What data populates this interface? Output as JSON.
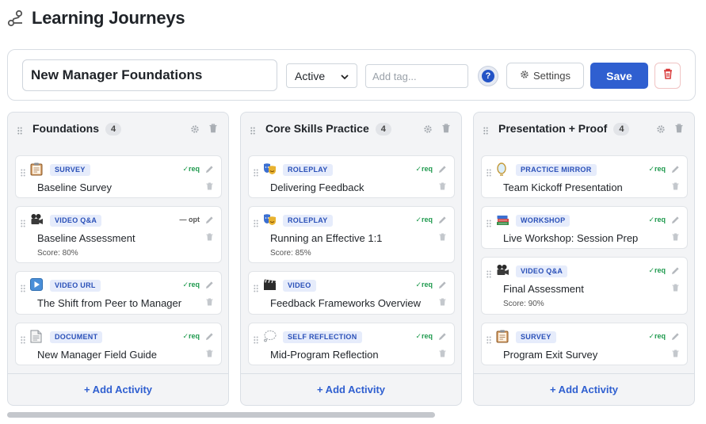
{
  "page": {
    "title": "Learning Journeys"
  },
  "toolbar": {
    "journey_name": "New Manager Foundations",
    "status_value": "Active",
    "tag_placeholder": "Add tag...",
    "help_label": "?",
    "settings_label": "Settings",
    "save_label": "Save"
  },
  "columns": [
    {
      "title": "Foundations",
      "count": "4",
      "add_label": "+ Add Activity",
      "cards": [
        {
          "icon": "clipboard-icon",
          "type": "SURVEY",
          "flag": "✓req",
          "title": "Baseline Survey",
          "score": ""
        },
        {
          "icon": "video-camera-icon",
          "type": "VIDEO Q&A",
          "flag": "— opt",
          "title": "Baseline Assessment",
          "score": "Score: 80%"
        },
        {
          "icon": "play-icon",
          "type": "VIDEO URL",
          "flag": "✓req",
          "title": "The Shift from Peer to Manager",
          "score": ""
        },
        {
          "icon": "document-icon",
          "type": "DOCUMENT",
          "flag": "✓req",
          "title": "New Manager Field Guide",
          "score": ""
        }
      ]
    },
    {
      "title": "Core Skills Practice",
      "count": "4",
      "add_label": "+ Add Activity",
      "cards": [
        {
          "icon": "masks-icon",
          "type": "ROLEPLAY",
          "flag": "✓req",
          "title": "Delivering Feedback",
          "score": ""
        },
        {
          "icon": "masks-icon",
          "type": "ROLEPLAY",
          "flag": "✓req",
          "title": "Running an Effective 1:1",
          "score": "Score: 85%"
        },
        {
          "icon": "clapper-icon",
          "type": "VIDEO",
          "flag": "✓req",
          "title": "Feedback Frameworks Overview",
          "score": ""
        },
        {
          "icon": "thought-bubble-icon",
          "type": "SELF REFLECTION",
          "flag": "✓req",
          "title": "Mid-Program Reflection",
          "score": ""
        }
      ]
    },
    {
      "title": "Presentation + Proof",
      "count": "4",
      "add_label": "+ Add Activity",
      "cards": [
        {
          "icon": "mirror-icon",
          "type": "PRACTICE MIRROR",
          "flag": "✓req",
          "title": "Team Kickoff Presentation",
          "score": ""
        },
        {
          "icon": "books-icon",
          "type": "WORKSHOP",
          "flag": "✓req",
          "title": "Live Workshop: Session Prep",
          "score": ""
        },
        {
          "icon": "video-camera-icon",
          "type": "VIDEO Q&A",
          "flag": "✓req",
          "title": "Final Assessment",
          "score": "Score: 90%"
        },
        {
          "icon": "clipboard-icon",
          "type": "SURVEY",
          "flag": "✓req",
          "title": "Program Exit Survey",
          "score": ""
        }
      ]
    }
  ],
  "colors": {
    "primary": "#2f5fd0",
    "req_green": "#1f9a4e",
    "badge_bg": "#e6ecfb",
    "badge_text": "#2a50b8",
    "danger": "#d93b3b"
  }
}
